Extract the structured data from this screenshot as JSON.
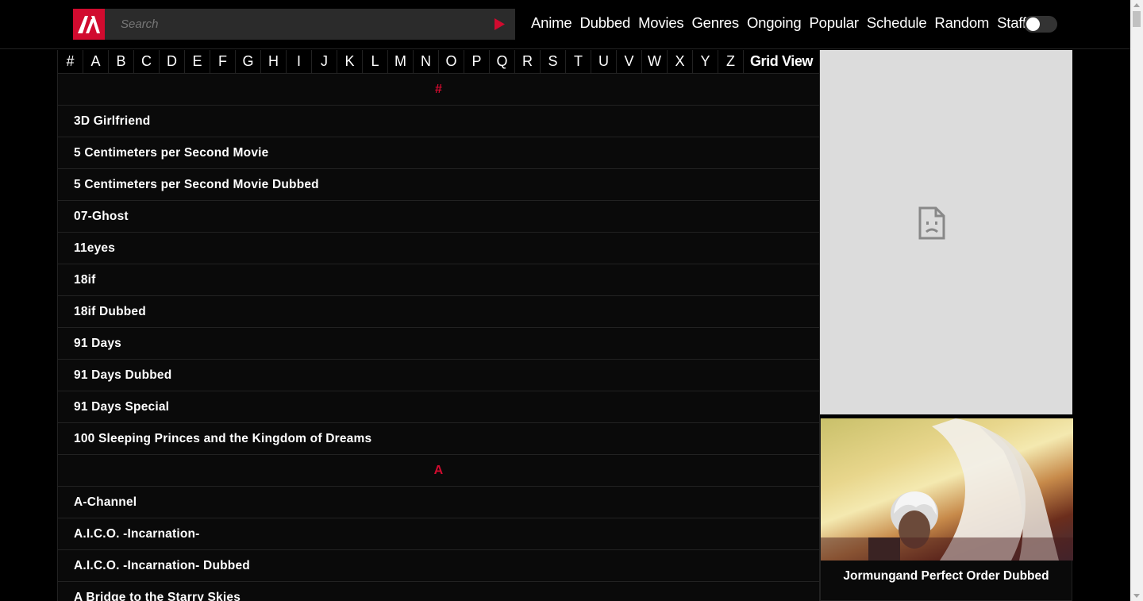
{
  "search": {
    "placeholder": "Search"
  },
  "nav": [
    "Anime",
    "Dubbed",
    "Movies",
    "Genres",
    "Ongoing",
    "Popular",
    "Schedule",
    "Random",
    "Staff"
  ],
  "alphabet": [
    "#",
    "A",
    "B",
    "C",
    "D",
    "E",
    "F",
    "G",
    "H",
    "I",
    "J",
    "K",
    "L",
    "M",
    "N",
    "O",
    "P",
    "Q",
    "R",
    "S",
    "T",
    "U",
    "V",
    "W",
    "X",
    "Y",
    "Z"
  ],
  "grid_view_label": "Grid View",
  "sections": [
    {
      "heading": "#",
      "items": [
        "3D Girlfriend",
        "5 Centimeters per Second Movie",
        "5 Centimeters per Second Movie Dubbed",
        "07-Ghost",
        "11eyes",
        "18if",
        "18if Dubbed",
        "91 Days",
        "91 Days Dubbed",
        "91 Days Special",
        "100 Sleeping Princes and the Kingdom of Dreams"
      ]
    },
    {
      "heading": "A",
      "items": [
        "A-Channel",
        "A.I.C.O. -Incarnation-",
        "A.I.C.O. -Incarnation- Dubbed",
        "A Bridge to the Starry Skies"
      ]
    }
  ],
  "feature": {
    "title": "Jormungand Perfect Order Dubbed"
  },
  "colors": {
    "accent": "#d10b2f",
    "background": "#000000",
    "row_bg": "#0a0a0a"
  }
}
